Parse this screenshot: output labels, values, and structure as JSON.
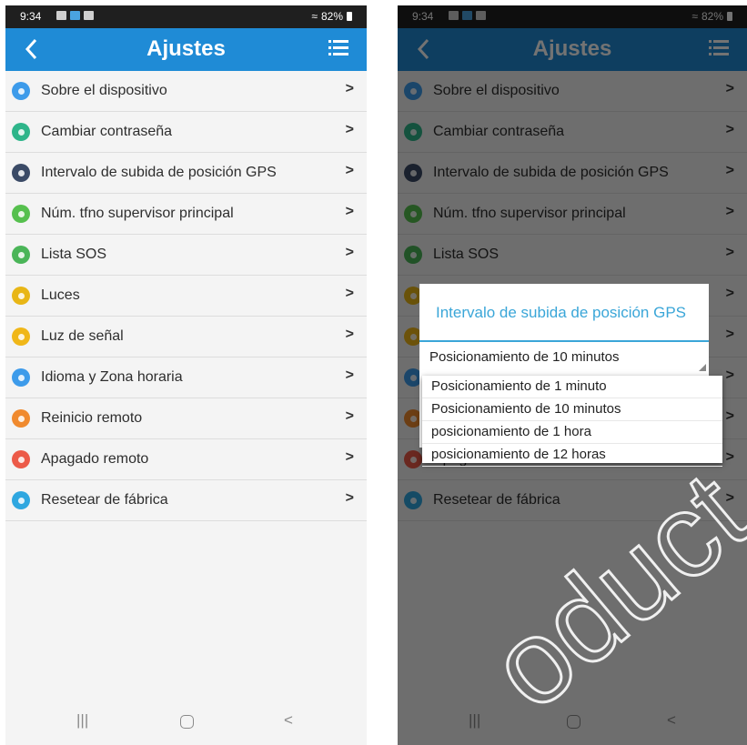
{
  "status_bar": {
    "time": "9:34",
    "battery": "82%"
  },
  "app_bar": {
    "title": "Ajustes",
    "color": "#1f8bd6"
  },
  "settings_items": [
    {
      "label": "Sobre el dispositivo",
      "icon": "device-info-icon",
      "color": "#3d9bea"
    },
    {
      "label": "Cambiar contraseña",
      "icon": "key-icon",
      "color": "#2eb58a"
    },
    {
      "label": "Intervalo de subida de posición GPS",
      "icon": "location-pin-icon",
      "color": "#3a4a66"
    },
    {
      "label": "Núm. tfno supervisor principal",
      "icon": "eye-icon",
      "color": "#56c04e"
    },
    {
      "label": "Lista SOS",
      "icon": "contacts-icon",
      "color": "#4ab558"
    },
    {
      "label": "Luces",
      "icon": "bulb-icon",
      "color": "#e8b616"
    },
    {
      "label": "Luz de señal",
      "icon": "signal-light-icon",
      "color": "#f0b718"
    },
    {
      "label": "Idioma y Zona horaria",
      "icon": "globe-icon",
      "color": "#3d9bea"
    },
    {
      "label": "Reinicio remoto",
      "icon": "restart-icon",
      "color": "#f08a2e"
    },
    {
      "label": "Apagado remoto",
      "icon": "power-icon",
      "color": "#ec5a48"
    },
    {
      "label": "Resetear de fábrica",
      "icon": "factory-reset-icon",
      "color": "#2fa7e0"
    }
  ],
  "chevron": ">",
  "dialog": {
    "title": "Intervalo de subida de posición GPS",
    "selected": "Posicionamiento de 10 minutos",
    "options": [
      "Posicionamiento de 1 minuto",
      "Posicionamiento de 10 minutos",
      "posicionamiento de 1 hora",
      "posicionamiento de 12 horas"
    ],
    "accent": "#3aa6d8"
  },
  "nav_bar": {
    "recents": "|||",
    "back": "<"
  },
  "watermark": "oduct"
}
